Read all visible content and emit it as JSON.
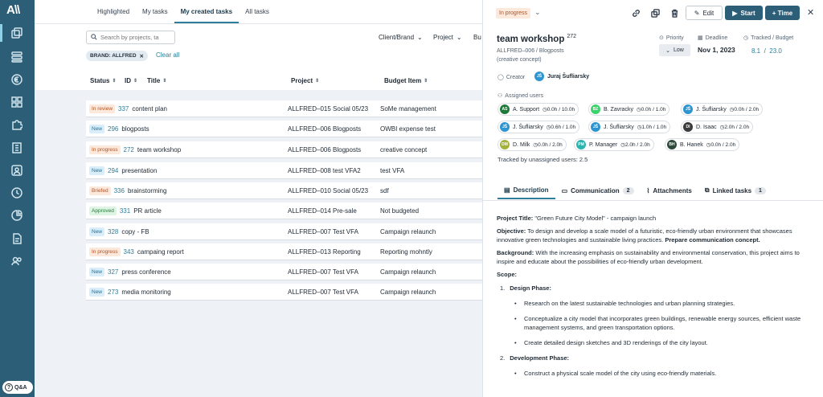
{
  "sidebar": {
    "logo": "A\\\\",
    "qa_label": "Q&A",
    "icons": [
      "copy-icon",
      "layers-icon",
      "euro-icon",
      "grid-icon",
      "puzzle-icon",
      "building-icon",
      "person-icon",
      "clock-icon",
      "chart-icon",
      "document-icon",
      "users-icon"
    ]
  },
  "main": {
    "tabs": [
      "Highlighted",
      "My tasks",
      "My created tasks",
      "All tasks"
    ],
    "active_tab": "My created tasks",
    "search_placeholder": "Search by projects, ta",
    "filters": [
      "Client/Brand",
      "Project",
      "Bu"
    ],
    "chip": "BRAND: ALLFRED",
    "clear_all": "Clear all",
    "columns": [
      "Status",
      "ID",
      "Title",
      "Project",
      "Budget Item"
    ],
    "rows": [
      {
        "status": "In review",
        "kind": "review",
        "id": "337",
        "title": "content plan",
        "project": "ALLFRED–015 Social 05/23",
        "budget": "SoMe management"
      },
      {
        "status": "New",
        "kind": "new",
        "id": "296",
        "title": "blogposts",
        "project": "ALLFRED–006 Blogposts",
        "budget": "OWBI expense test"
      },
      {
        "status": "In progress",
        "kind": "progress",
        "id": "272",
        "title": "team workshop",
        "project": "ALLFRED–006 Blogposts",
        "budget": "creative concept"
      },
      {
        "status": "New",
        "kind": "new",
        "id": "294",
        "title": "presentation",
        "project": "ALLFRED–008 test VFA2",
        "budget": "test VFA"
      },
      {
        "status": "Briefed",
        "kind": "briefed",
        "id": "336",
        "title": "brainstorming",
        "project": "ALLFRED–010 Social 05/23",
        "budget": "sdf"
      },
      {
        "status": "Approved",
        "kind": "approved",
        "id": "331",
        "title": "PR article",
        "project": "ALLFRED–014 Pre-sale",
        "budget": "Not budgeted"
      },
      {
        "status": "New",
        "kind": "new",
        "id": "328",
        "title": "copy - FB",
        "project": "ALLFRED–007 Test VFA",
        "budget": "Campaign relaunch"
      },
      {
        "status": "In progress",
        "kind": "progress",
        "id": "343",
        "title": "campaing report",
        "project": "ALLFRED–013 Reporting",
        "budget": "Reporting mohntly"
      },
      {
        "status": "New",
        "kind": "new",
        "id": "327",
        "title": "press conference",
        "project": "ALLFRED–007 Test VFA",
        "budget": "Campaign relaunch"
      },
      {
        "status": "New",
        "kind": "new",
        "id": "273",
        "title": "media monitoring",
        "project": "ALLFRED–007 Test VFA",
        "budget": "Campaign relaunch"
      }
    ]
  },
  "detail": {
    "status": "In progress",
    "edit_label": "Edit",
    "start_label": "Start",
    "time_label": "+ Time",
    "title": "team workshop",
    "task_id": "272",
    "project_line": "ALLFRED–006 / Blogposts",
    "budget_line": "(creative concept)",
    "priority_label": "Priority",
    "priority_value": "Low",
    "deadline_label": "Deadline",
    "deadline_value": "Nov 1, 2023",
    "tracked_label": "Tracked / Budget",
    "tracked_value": "8.1",
    "budget_value": "23.0",
    "creator_label": "Creator",
    "creator": {
      "initials": "JŠ",
      "name": "Juraj Šufliarsky",
      "color": "#2f95d0"
    },
    "assigned_label": "Assigned users",
    "users": [
      {
        "initials": "AS",
        "name": "A. Support",
        "time": "0.0h / 10.0h",
        "color": "#1f7a3a"
      },
      {
        "initials": "BZ",
        "name": "B. Zavracky",
        "time": "0.0h / 1.0h",
        "color": "#3bd36b"
      },
      {
        "initials": "JŠ",
        "name": "J. Šufliarsky",
        "time": "0.0h / 2.0h",
        "color": "#2f95d0"
      },
      {
        "initials": "JŠ",
        "name": "J. Šufliarsky",
        "time": "0.6h / 1.0h",
        "color": "#2f95d0"
      },
      {
        "initials": "JŠ",
        "name": "J. Šufliarsky",
        "time": "1.0h / 1.0h",
        "color": "#2f95d0"
      },
      {
        "initials": "DI",
        "name": "D. Isaac",
        "time": "2.0h / 2.0h",
        "color": "#3b3b3b"
      },
      {
        "initials": "DM",
        "name": "D. Milk",
        "time": "0.0h / 2.0h",
        "color": "#a5b23a"
      },
      {
        "initials": "PM",
        "name": "P. Manager",
        "time": "2.0h / 2.0h",
        "color": "#2bb5b0"
      },
      {
        "initials": "BH",
        "name": "B. Hanek",
        "time": "0.0h / 2.0h",
        "color": "#2e4a3a"
      }
    ],
    "unassigned": "Tracked by unassigned users: 2.5",
    "tabs": [
      {
        "label": "Description",
        "count": ""
      },
      {
        "label": "Communication",
        "count": "2"
      },
      {
        "label": "Attachments",
        "count": ""
      },
      {
        "label": "Linked tasks",
        "count": "1"
      }
    ],
    "description": {
      "title_label": "Project Title:",
      "title_text": "\"Green Future City Model\" - campaign launch",
      "objective_label": "Objective:",
      "objective_text": "To design and develop a scale model of a futuristic, eco-friendly urban environment that showcases innovative green technologies and sustainable living practices.",
      "objective_bold": "Prepare communication concept.",
      "background_label": "Background:",
      "background_text": "With the increasing emphasis on sustainability and environmental conservation, this project aims to inspire and educate about the possibilities of eco-friendly urban development.",
      "scope_label": "Scope:",
      "phase1": "Design Phase:",
      "phase1_items": [
        "Research on the latest sustainable technologies and urban planning strategies.",
        "Conceptualize a city model that incorporates green buildings, renewable energy sources, efficient waste management systems, and green transportation options.",
        "Create detailed design sketches and 3D renderings of the city layout."
      ],
      "phase2": "Development Phase:",
      "phase2_items": [
        "Construct a physical scale model of the city using eco-friendly materials."
      ]
    }
  }
}
